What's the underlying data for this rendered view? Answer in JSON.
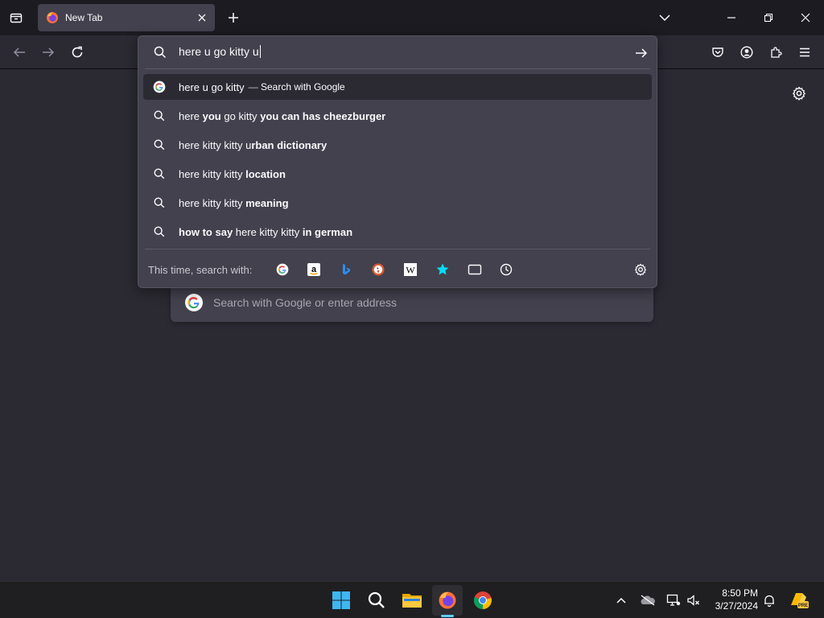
{
  "tabs": [
    {
      "title": "New Tab",
      "favicon": "firefox-icon"
    }
  ],
  "urlbar": {
    "input_value": "here u go kitty u",
    "go_icon": "arrow-right-icon",
    "results": [
      {
        "type": "search-engine",
        "icon": "google-icon",
        "text": "here u go kitty",
        "separator": "—",
        "action": "Search with Google",
        "selected": true
      },
      {
        "type": "suggestion",
        "icon": "search-icon",
        "parts": [
          {
            "t": "here ",
            "b": false
          },
          {
            "t": "you",
            "b": true
          },
          {
            "t": " go kitty ",
            "b": false
          },
          {
            "t": "you can has cheezburger",
            "b": true
          }
        ]
      },
      {
        "type": "suggestion",
        "icon": "search-icon",
        "parts": [
          {
            "t": "here kitty kitty u",
            "b": false
          },
          {
            "t": "rban dictionary",
            "b": true
          }
        ]
      },
      {
        "type": "suggestion",
        "icon": "search-icon",
        "parts": [
          {
            "t": "here kitty kitty ",
            "b": false
          },
          {
            "t": "location",
            "b": true
          }
        ]
      },
      {
        "type": "suggestion",
        "icon": "search-icon",
        "parts": [
          {
            "t": "here kitty kitty ",
            "b": false
          },
          {
            "t": "meaning",
            "b": true
          }
        ]
      },
      {
        "type": "suggestion",
        "icon": "search-icon",
        "parts": [
          {
            "t": "how to say",
            "b": true
          },
          {
            "t": " here kitty kitty ",
            "b": false
          },
          {
            "t": "in german",
            "b": true
          }
        ]
      }
    ],
    "oneoff_label": "This time, search with:",
    "oneoff_engines": [
      "google-icon",
      "amazon-icon",
      "bing-icon",
      "duckduckgo-icon",
      "wikipedia-icon",
      "bookmarks-star-icon",
      "tabs-icon",
      "history-clock-icon"
    ]
  },
  "newtab": {
    "search_placeholder": "Search with Google or enter address"
  },
  "taskbar": {
    "apps": [
      "windows-start-icon",
      "search-icon",
      "file-explorer-icon",
      "firefox-icon",
      "chrome-icon"
    ],
    "tray": [
      "chevron-up-icon",
      "onedrive-offline-icon",
      "network-icon",
      "volume-muted-icon",
      "notifications-bell-icon",
      "copilot-pre-icon"
    ],
    "time": "8:50 PM",
    "date": "3/27/2024"
  },
  "colors": {
    "background": "#2b2a33",
    "tabstrip": "#1c1b22",
    "popup": "#42414d",
    "accent": "#60cdff"
  }
}
